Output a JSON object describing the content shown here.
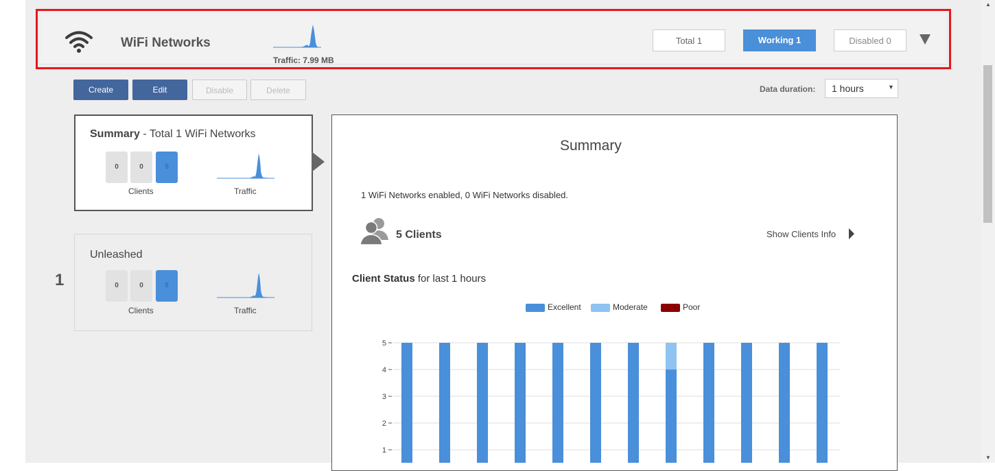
{
  "header": {
    "title": "WiFi Networks",
    "traffic": "Traffic: 7.99 MB",
    "stats": {
      "total": "Total 1",
      "working": "Working 1",
      "disabled": "Disabled 0"
    }
  },
  "toolbar": {
    "create": "Create",
    "edit": "Edit",
    "disable": "Disable",
    "delete": "Delete",
    "duration_label": "Data duration:",
    "duration_value": "1 hours"
  },
  "cards": {
    "summary": {
      "title_bold": "Summary",
      "title_rest": " - Total 1 WiFi Networks",
      "counts": [
        "0",
        "0",
        "5"
      ],
      "clients_label": "Clients",
      "traffic_label": "Traffic"
    },
    "unleashed": {
      "index": "1",
      "title": "Unleashed",
      "counts": [
        "0",
        "0",
        "5"
      ],
      "clients_label": "Clients",
      "traffic_label": "Traffic"
    }
  },
  "panel": {
    "title": "Summary",
    "status_text": "1 WiFi Networks enabled, 0 WiFi Networks disabled.",
    "clients_count": "5 Clients",
    "show_clients": "Show Clients Info",
    "client_status_bold": "Client Status",
    "client_status_rest": " for last 1 hours",
    "legend": [
      {
        "label": "Excellent",
        "color": "#4a8fd9"
      },
      {
        "label": "Moderate",
        "color": "#8ec3f2"
      },
      {
        "label": "Poor",
        "color": "#8b0000"
      }
    ]
  },
  "colors": {
    "accent": "#4a8fd9",
    "button_primary": "#43669d",
    "highlight_border": "#e8151b"
  },
  "chart_data": {
    "type": "bar",
    "stacked": true,
    "title": "",
    "xlabel": "",
    "ylabel": "",
    "ylim": [
      0,
      5
    ],
    "yticks": [
      1,
      2,
      3,
      4,
      5
    ],
    "grid": true,
    "series": [
      {
        "name": "Excellent",
        "values": [
          5,
          5,
          5,
          5,
          5,
          5,
          5,
          4,
          5,
          5,
          5,
          5
        ]
      },
      {
        "name": "Moderate",
        "values": [
          0,
          0,
          0,
          0,
          0,
          0,
          0,
          1,
          0,
          0,
          0,
          0
        ]
      },
      {
        "name": "Poor",
        "values": [
          0,
          0,
          0,
          0,
          0,
          0,
          0,
          0,
          0,
          0,
          0,
          0
        ]
      }
    ]
  }
}
